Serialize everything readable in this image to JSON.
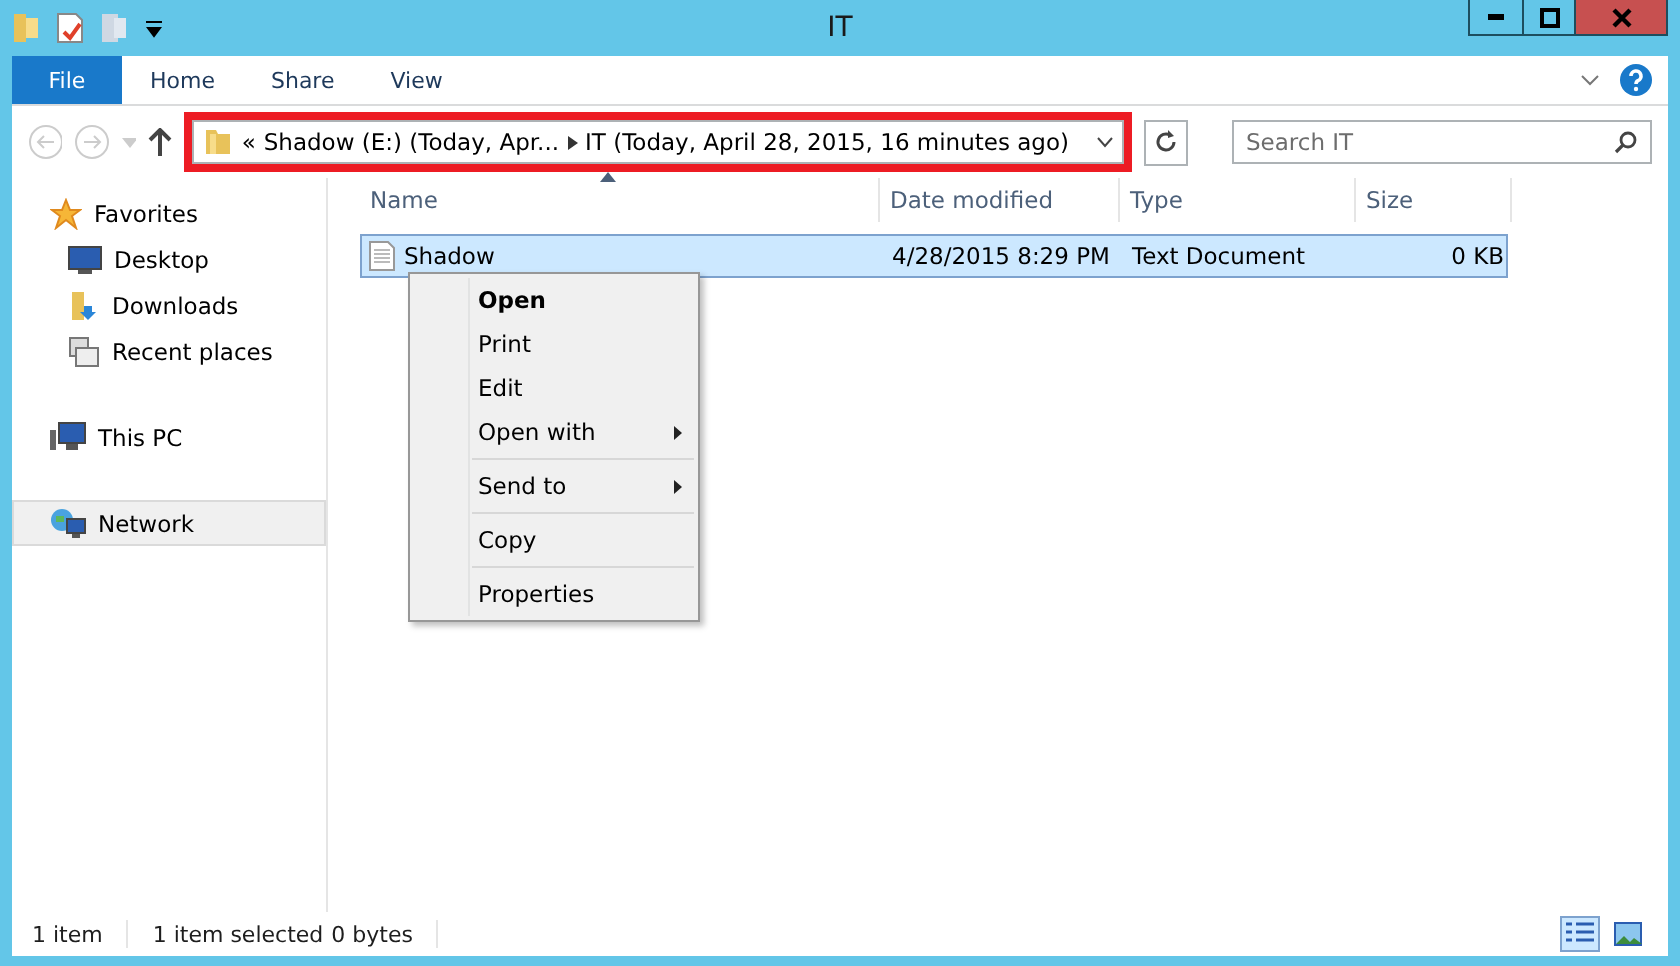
{
  "window": {
    "title": "IT"
  },
  "ribbon": {
    "tabs": [
      {
        "label": "File",
        "kind": "file"
      },
      {
        "label": "Home",
        "kind": "tab"
      },
      {
        "label": "Share",
        "kind": "tab"
      },
      {
        "label": "View",
        "kind": "tab"
      }
    ]
  },
  "address": {
    "highlighted": true,
    "segments": [
      "Shadow (E:) (Today, Apr...",
      "IT (Today, April 28, 2015, 16 minutes ago)"
    ],
    "overflow": "«"
  },
  "search": {
    "placeholder": "Search IT"
  },
  "sidebar": {
    "items": [
      {
        "label": "Favorites",
        "selected": false,
        "children": [
          {
            "label": "Desktop",
            "selected": false
          },
          {
            "label": "Downloads",
            "selected": false
          },
          {
            "label": "Recent places",
            "selected": false
          }
        ]
      },
      {
        "label": "This PC",
        "selected": false
      },
      {
        "label": "Network",
        "selected": true
      }
    ]
  },
  "table": {
    "columns": [
      "Name",
      "Date modified",
      "Type",
      "Size"
    ],
    "rows": [
      {
        "name": "Shadow",
        "date": "4/28/2015 8:29 PM",
        "type": "Text Document",
        "size": "0 KB",
        "selected": true
      }
    ]
  },
  "context_menu": {
    "sections": [
      [
        {
          "label": "Open",
          "default": true,
          "submenu": false
        },
        {
          "label": "Print",
          "default": false,
          "submenu": false
        },
        {
          "label": "Edit",
          "default": false,
          "submenu": false
        },
        {
          "label": "Open with",
          "default": false,
          "submenu": true
        }
      ],
      [
        {
          "label": "Send to",
          "default": false,
          "submenu": true
        }
      ],
      [
        {
          "label": "Copy",
          "default": false,
          "submenu": false
        }
      ],
      [
        {
          "label": "Properties",
          "default": false,
          "submenu": false
        }
      ]
    ]
  },
  "status_bar": {
    "count": "1 item",
    "selection": "1 item selected",
    "size": "0 bytes",
    "views": [
      {
        "kind": "details",
        "selected": true
      },
      {
        "kind": "large-icons",
        "selected": false
      }
    ]
  }
}
